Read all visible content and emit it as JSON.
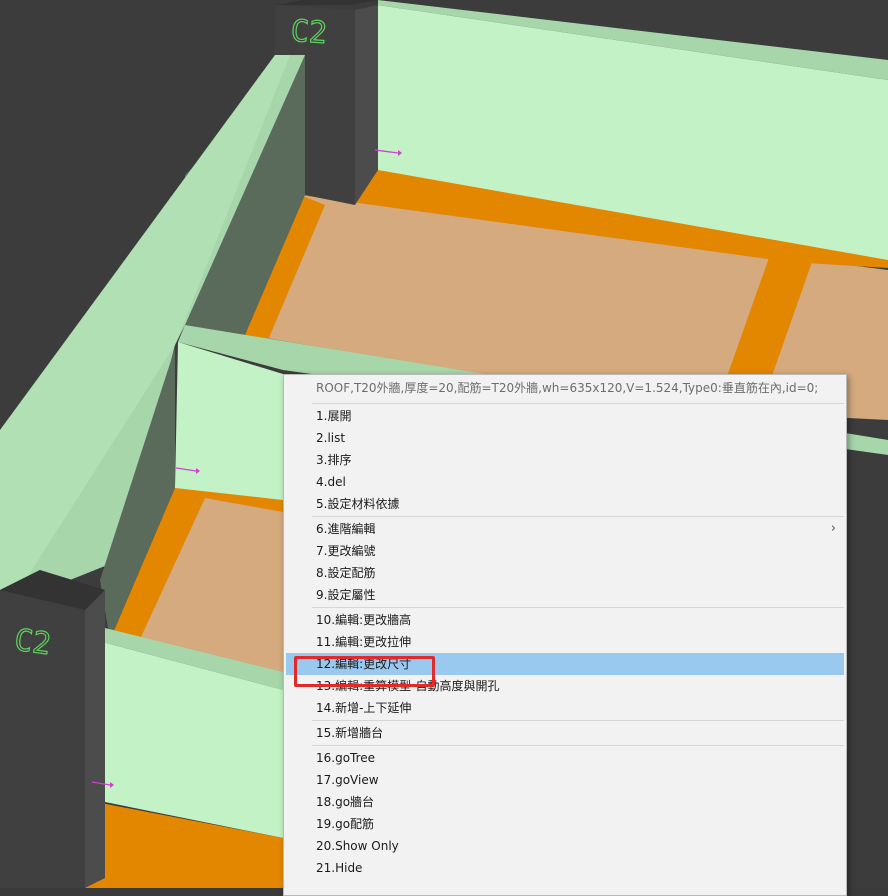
{
  "scene": {
    "column_labels": [
      "C2",
      "C2"
    ],
    "colors": {
      "wall_face": "#c2f2c6",
      "wall_top": "#a6d6aa",
      "wall_shadow": "#5a6b5c",
      "beam": "#e38600",
      "slab": "#d4aa7e",
      "column": "#404040",
      "column_label": "#5fd35f",
      "marker": "#d23fd2"
    }
  },
  "menu": {
    "header": "ROOF,T20外牆,厚度=20,配筋=T20外牆,wh=635x120,V=1.524,Type0:垂直筋在內,id=0;",
    "groups": [
      [
        {
          "label": "1.展開"
        },
        {
          "label": "2.list"
        },
        {
          "label": "3.排序"
        },
        {
          "label": "4.del"
        },
        {
          "label": "5.設定材料依據"
        }
      ],
      [
        {
          "label": "6.進階編輯",
          "submenu": "›"
        },
        {
          "label": "7.更改編號"
        },
        {
          "label": "8.設定配筋"
        },
        {
          "label": "9.設定屬性"
        }
      ],
      [
        {
          "label": "10.編輯:更改牆高"
        },
        {
          "label": "11.編輯:更改拉伸"
        },
        {
          "label": "12.編輯:更改尺寸"
        },
        {
          "label": "13.編輯:重算模型-自動高度與開孔"
        },
        {
          "label": "14.新增-上下延伸"
        }
      ],
      [
        {
          "label": "15.新增牆台"
        }
      ],
      [
        {
          "label": "16.goTree"
        },
        {
          "label": "17.goView"
        },
        {
          "label": "18.go牆台"
        },
        {
          "label": "19.go配筋"
        },
        {
          "label": "20.Show Only"
        },
        {
          "label": "21.Hide"
        }
      ]
    ],
    "selected": "12.編輯:更改尺寸"
  }
}
